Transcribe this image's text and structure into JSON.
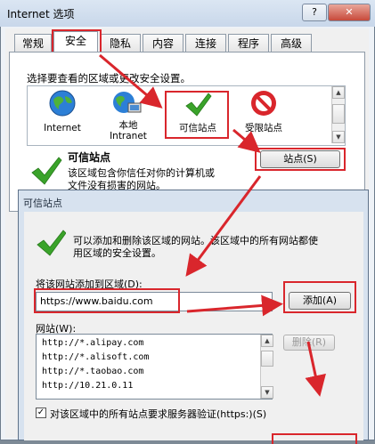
{
  "window": {
    "title": "Internet 选项",
    "help_button": "?",
    "close_button": "✕"
  },
  "tabs": [
    {
      "label": "常规"
    },
    {
      "label": "安全"
    },
    {
      "label": "隐私"
    },
    {
      "label": "内容"
    },
    {
      "label": "连接"
    },
    {
      "label": "程序"
    },
    {
      "label": "高级"
    }
  ],
  "security": {
    "instruction": "选择要查看的区域或更改安全设置。",
    "zones": [
      {
        "label": "Internet",
        "icon": "globe-icon"
      },
      {
        "label": "本地\nIntranet",
        "icon": "intranet-icon"
      },
      {
        "label": "可信站点",
        "icon": "check-icon"
      },
      {
        "label": "受限站点",
        "icon": "no-entry-icon"
      }
    ],
    "selected_zone_title": "可信站点",
    "selected_zone_desc_1": "该区域包含你信任对你的计算机或",
    "selected_zone_desc_2": "文件没有损害的网站。",
    "sites_button": "站点(S)"
  },
  "trusted_dialog": {
    "title": "可信站点",
    "info_1": "可以添加和删除该区域的网站。该区域中的所有网站都使",
    "info_2": "用区域的安全设置。",
    "add_label": "将该网站添加到区域(D):",
    "add_value": "https://www.baidu.com",
    "add_button": "添加(A)",
    "sites_label": "网站(W):",
    "sites": [
      "http://*.alipay.com",
      "http://*.alisoft.com",
      "http://*.taobao.com",
      "http://10.21.0.11"
    ],
    "remove_button": "删除(R)",
    "require_https_label": "对该区域中的所有站点要求服务器验证(https:)(S)",
    "require_https_checked": true
  },
  "colors": {
    "annotation_red": "#d9262c",
    "check_green": "#3aa32a"
  }
}
